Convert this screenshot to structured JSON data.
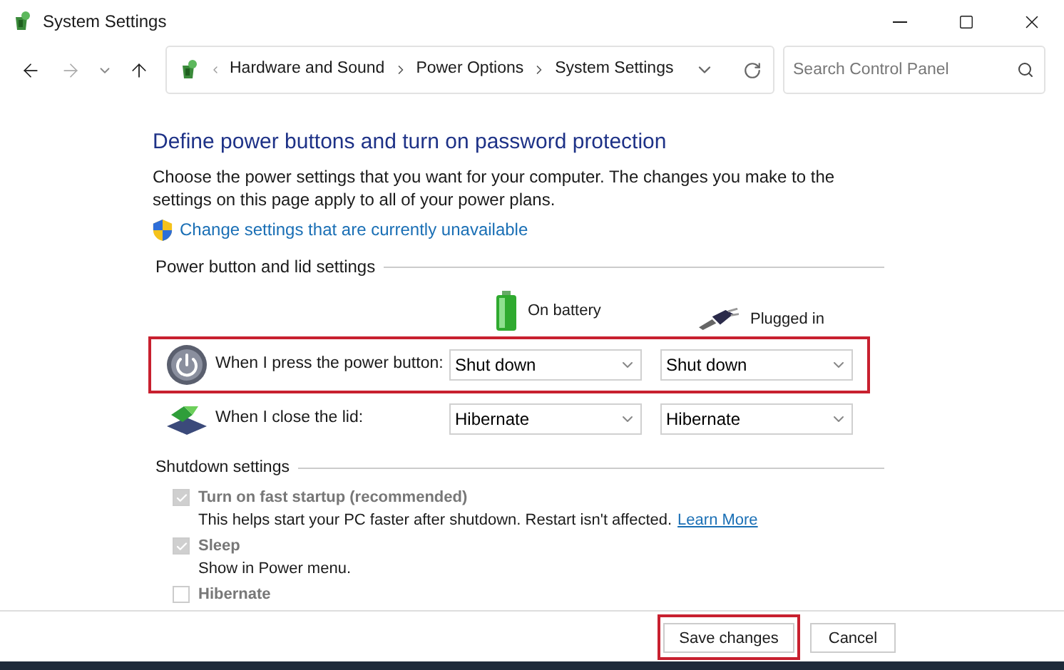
{
  "window": {
    "title": "System Settings"
  },
  "address_bar": {
    "crumbs": [
      "Hardware and Sound",
      "Power Options",
      "System Settings"
    ]
  },
  "search": {
    "placeholder": "Search Control Panel"
  },
  "heading": "Define power buttons and turn on password protection",
  "intro": "Choose the power settings that you want for your computer. The changes you make to the settings on this page apply to all of your power plans.",
  "admin_link": "Change settings that are currently unavailable",
  "power_section": {
    "title": "Power button and lid settings",
    "columns": [
      "On battery",
      "Plugged in"
    ],
    "rows": [
      {
        "kind": "power",
        "label": "When I press the power button:",
        "values": [
          "Shut down",
          "Shut down"
        ],
        "highlighted": true
      },
      {
        "kind": "lid",
        "label": "When I close the lid:",
        "values": [
          "Hibernate",
          "Hibernate"
        ],
        "highlighted": false
      }
    ]
  },
  "shutdown_section": {
    "title": "Shutdown settings",
    "options": [
      {
        "label": "Turn on fast startup (recommended)",
        "checked": true,
        "disabled": true,
        "description": "This helps start your PC faster after shutdown. Restart isn't affected.",
        "link": "Learn More"
      },
      {
        "label": "Sleep",
        "checked": true,
        "disabled": true,
        "description": "Show in Power menu."
      },
      {
        "label": "Hibernate",
        "checked": false,
        "disabled": true
      }
    ]
  },
  "buttons": [
    {
      "label": "Save changes",
      "highlighted": true
    },
    {
      "label": "Cancel",
      "highlighted": false
    }
  ]
}
